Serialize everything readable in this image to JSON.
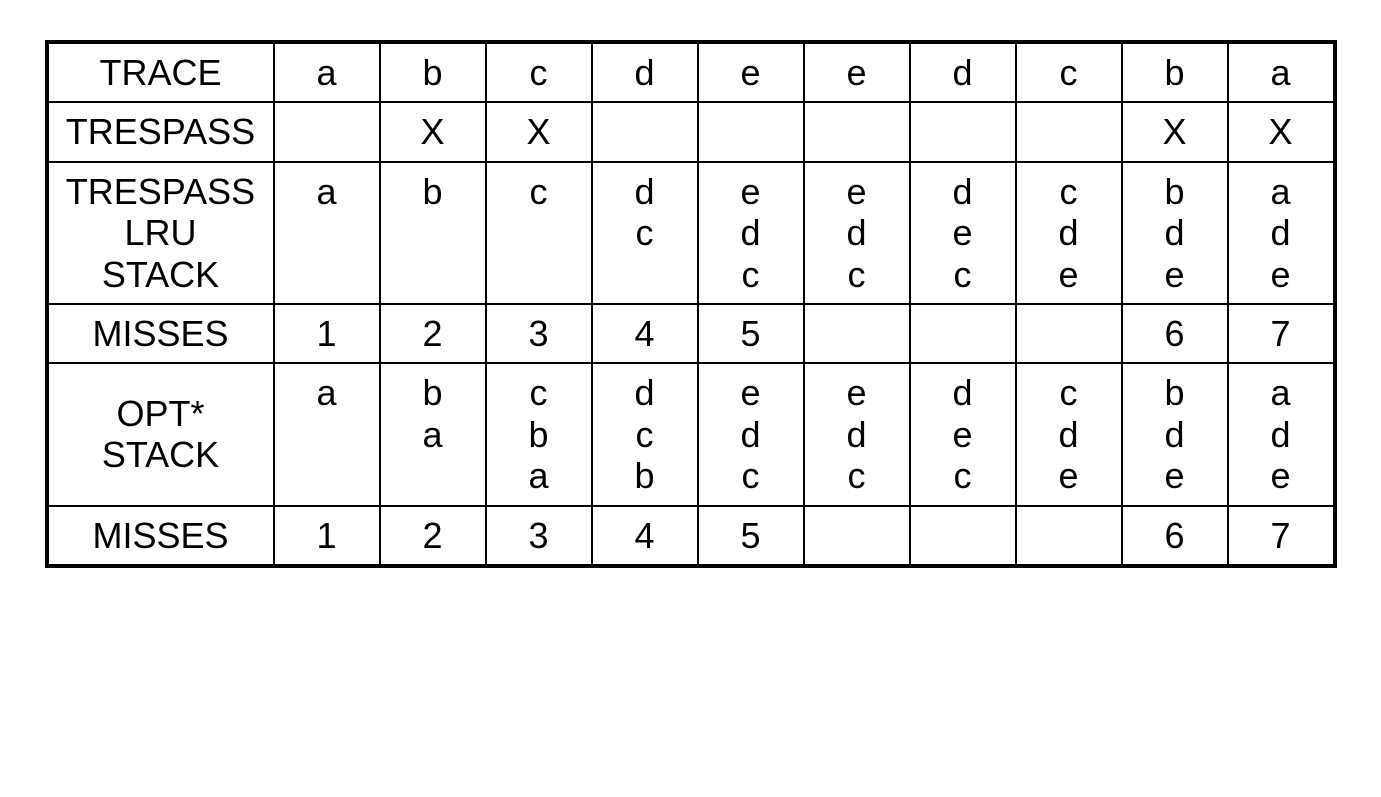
{
  "rows": [
    {
      "label": "TRACE",
      "single": true,
      "cells": [
        "a",
        "b",
        "c",
        "d",
        "e",
        "e",
        "d",
        "c",
        "b",
        "a"
      ]
    },
    {
      "label": "TRESPASS",
      "single": true,
      "cells": [
        "",
        "X",
        "X",
        "",
        "",
        "",
        "",
        "",
        "X",
        "X"
      ]
    },
    {
      "label": "TRESPASS\nLRU\nSTACK",
      "single": false,
      "cells": [
        "a",
        "b",
        "c",
        "d\nc",
        "e\nd\nc",
        "e\nd\nc",
        "d\ne\nc",
        "c\nd\ne",
        "b\nd\ne",
        "a\nd\ne"
      ]
    },
    {
      "label": "MISSES",
      "single": true,
      "cells": [
        "1",
        "2",
        "3",
        "4",
        "5",
        "",
        "",
        "",
        "6",
        "7"
      ]
    },
    {
      "label": "OPT*\nSTACK",
      "single": false,
      "cells": [
        "a",
        "b\na",
        "c\nb\na",
        "d\nc\nb",
        "e\nd\nc",
        "e\nd\nc",
        "d\ne\nc",
        "c\nd\ne",
        "b\nd\ne",
        "a\nd\ne"
      ]
    },
    {
      "label": "MISSES",
      "single": true,
      "cells": [
        "1",
        "2",
        "3",
        "4",
        "5",
        "",
        "",
        "",
        "6",
        "7"
      ]
    }
  ]
}
